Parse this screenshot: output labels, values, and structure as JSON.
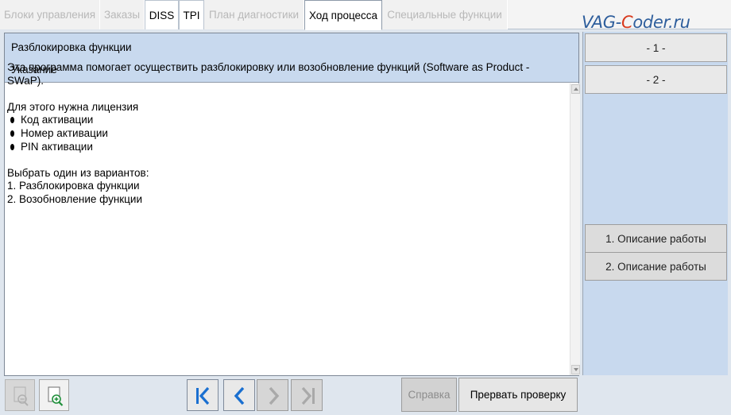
{
  "tabs": [
    {
      "label": "Блоки управления",
      "state": "disabled"
    },
    {
      "label": "Заказы",
      "state": "disabled"
    },
    {
      "label": "DISS",
      "state": "enabled"
    },
    {
      "label": "TPI",
      "state": "enabled"
    },
    {
      "label": "План диагностики",
      "state": "disabled"
    },
    {
      "label": "Ход процесса",
      "state": "active"
    },
    {
      "label": "Специальные функции",
      "state": "disabled"
    }
  ],
  "watermark": {
    "prefix": "VAG-",
    "highlight": "C",
    "suffix": "oder.ru"
  },
  "main": {
    "title": "Разблокировка функции",
    "subtitle": "Указание",
    "intro_line1": "Эта программа помогает осуществить разблокировку или возобновление функций (Software as Product -",
    "intro_line2": "SWaP).",
    "license_heading": "Для этого нужна лицензия",
    "license_items": [
      "Код активации",
      "Номер активации",
      "PIN активации"
    ],
    "choose_heading": "Выбрать один из вариантов:",
    "options": [
      "1. Разблокировка функции",
      "2. Возобновление функции"
    ]
  },
  "right_panel": {
    "top_buttons": [
      "- 1 -",
      "- 2 -"
    ],
    "desc_buttons": [
      "1. Описание работы",
      "2. Описание работы"
    ]
  },
  "bottom": {
    "help_label": "Справка",
    "abort_label": "Прервать проверку"
  },
  "icons": {
    "zoom_out": "zoom-out-icon",
    "zoom_in": "zoom-in-document-icon",
    "first": "skip-first-icon",
    "back": "arrow-left-icon",
    "forward": "arrow-right-icon",
    "last": "skip-last-icon"
  },
  "colors": {
    "accent_blue": "#1a6fd0",
    "panel_blue": "#c8d9ee",
    "logo_blue": "#2e5e9c",
    "logo_red": "#d83a1e"
  }
}
